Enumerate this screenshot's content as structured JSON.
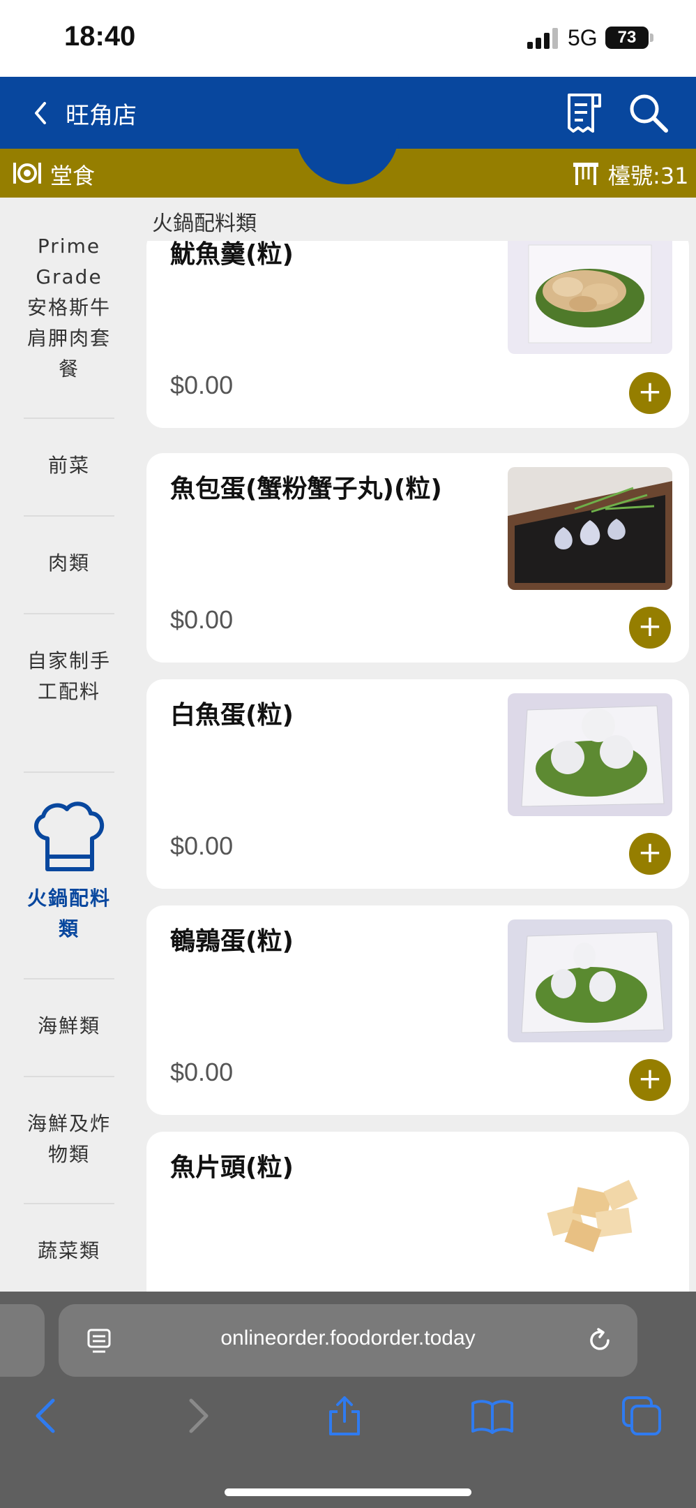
{
  "status_bar": {
    "time": "18:40",
    "network": "5G",
    "battery": "73"
  },
  "header": {
    "back_label": "",
    "title": "旺角店"
  },
  "mode_bar": {
    "mode_label": "堂食",
    "table_label": "檯號:31"
  },
  "sidebar": {
    "items": [
      {
        "label": "Prime Grade 安格斯牛肩胛肉套餐",
        "active": false
      },
      {
        "label": "前菜",
        "active": false
      },
      {
        "label": "肉類",
        "active": false
      },
      {
        "label": "自家制手工配料",
        "active": false
      },
      {
        "label": "火鍋配料類",
        "active": true
      },
      {
        "label": "海鮮類",
        "active": false
      },
      {
        "label": "海鮮及炸物類",
        "active": false
      },
      {
        "label": "蔬菜類",
        "active": false
      }
    ]
  },
  "section": {
    "title": "火鍋配料類"
  },
  "products": [
    {
      "name": "魷魚羹(粒)",
      "price": "$0.00",
      "image": "squid-paste-skewers"
    },
    {
      "name": "魚包蛋(蟹粉蟹子丸)(粒)",
      "price": "$0.00",
      "image": "fish-dumplings"
    },
    {
      "name": "白魚蛋(粒)",
      "price": "$0.00",
      "image": "white-fish-balls"
    },
    {
      "name": "鵪鶉蛋(粒)",
      "price": "$0.00",
      "image": "quail-eggs"
    },
    {
      "name": "魚片頭(粒)",
      "price": "",
      "image": "fried-fish-cubes"
    }
  ],
  "browser": {
    "url": "onlineorder.foodorder.today"
  },
  "colors": {
    "primary": "#08479e",
    "accent": "#957e00",
    "background": "#eeeeee"
  }
}
